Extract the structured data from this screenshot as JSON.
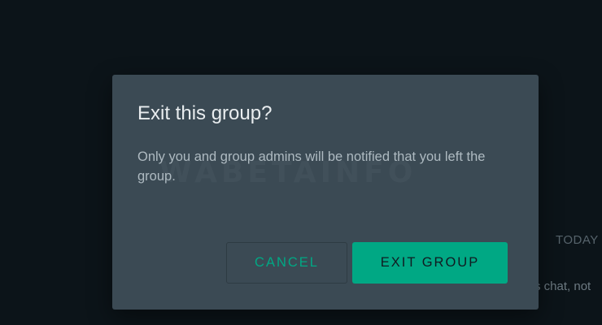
{
  "background": {
    "date_label": "TODAY",
    "message_snippet": "s chat, not"
  },
  "dialog": {
    "title": "Exit this group?",
    "body": "Only you and group admins will be notified that you left the group.",
    "watermark": "WABETAINFO",
    "cancel_label": "CANCEL",
    "confirm_label": "EXIT GROUP"
  },
  "colors": {
    "accent": "#00a884",
    "dialog_background": "#3b4a54",
    "page_background": "#0c1419",
    "title_text": "#e9edef",
    "body_text": "#aebac1"
  }
}
